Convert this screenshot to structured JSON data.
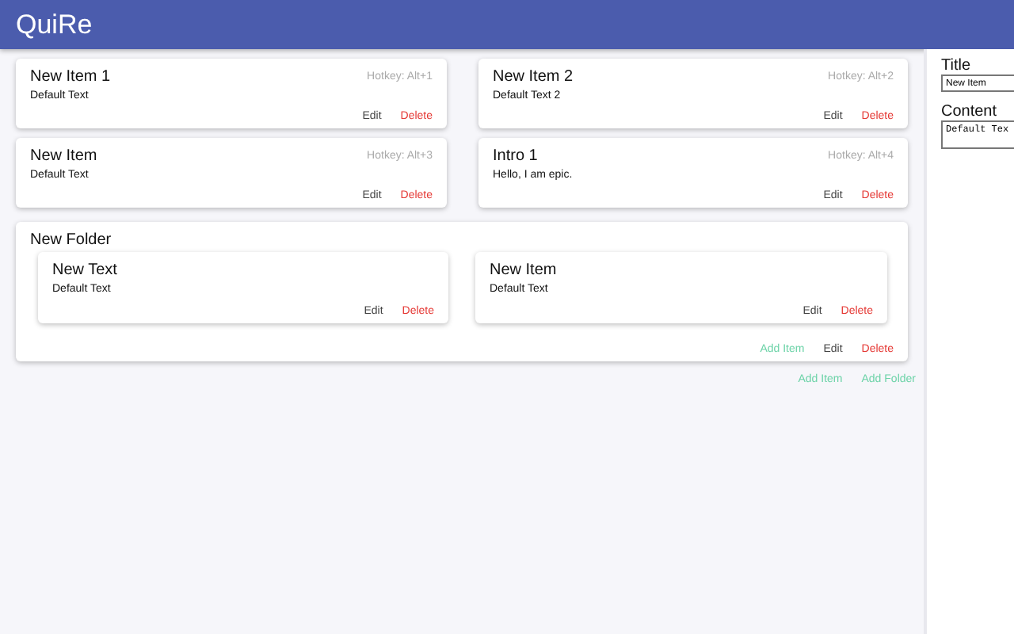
{
  "app_title": "QuiRe",
  "items": [
    {
      "title": "New Item 1",
      "hotkey": "Hotkey: Alt+1",
      "text": "Default Text",
      "edit": "Edit",
      "delete": "Delete"
    },
    {
      "title": "New Item 2",
      "hotkey": "Hotkey: Alt+2",
      "text": "Default Text 2",
      "edit": "Edit",
      "delete": "Delete"
    },
    {
      "title": "New Item",
      "hotkey": "Hotkey: Alt+3",
      "text": "Default Text",
      "edit": "Edit",
      "delete": "Delete"
    },
    {
      "title": "Intro 1",
      "hotkey": "Hotkey: Alt+4",
      "text": "Hello, I am epic.",
      "edit": "Edit",
      "delete": "Delete"
    }
  ],
  "folder": {
    "name": "New Folder",
    "items": [
      {
        "title": "New Text",
        "text": "Default Text",
        "edit": "Edit",
        "delete": "Delete"
      },
      {
        "title": "New Item",
        "text": "Default Text",
        "edit": "Edit",
        "delete": "Delete"
      }
    ],
    "add_item": "Add Item",
    "edit": "Edit",
    "delete": "Delete"
  },
  "add_item": "Add Item",
  "add_folder": "Add Folder",
  "editor": {
    "title_label": "Title",
    "title_value": "New Item",
    "content_label": "Content",
    "content_value": "Default Tex"
  }
}
